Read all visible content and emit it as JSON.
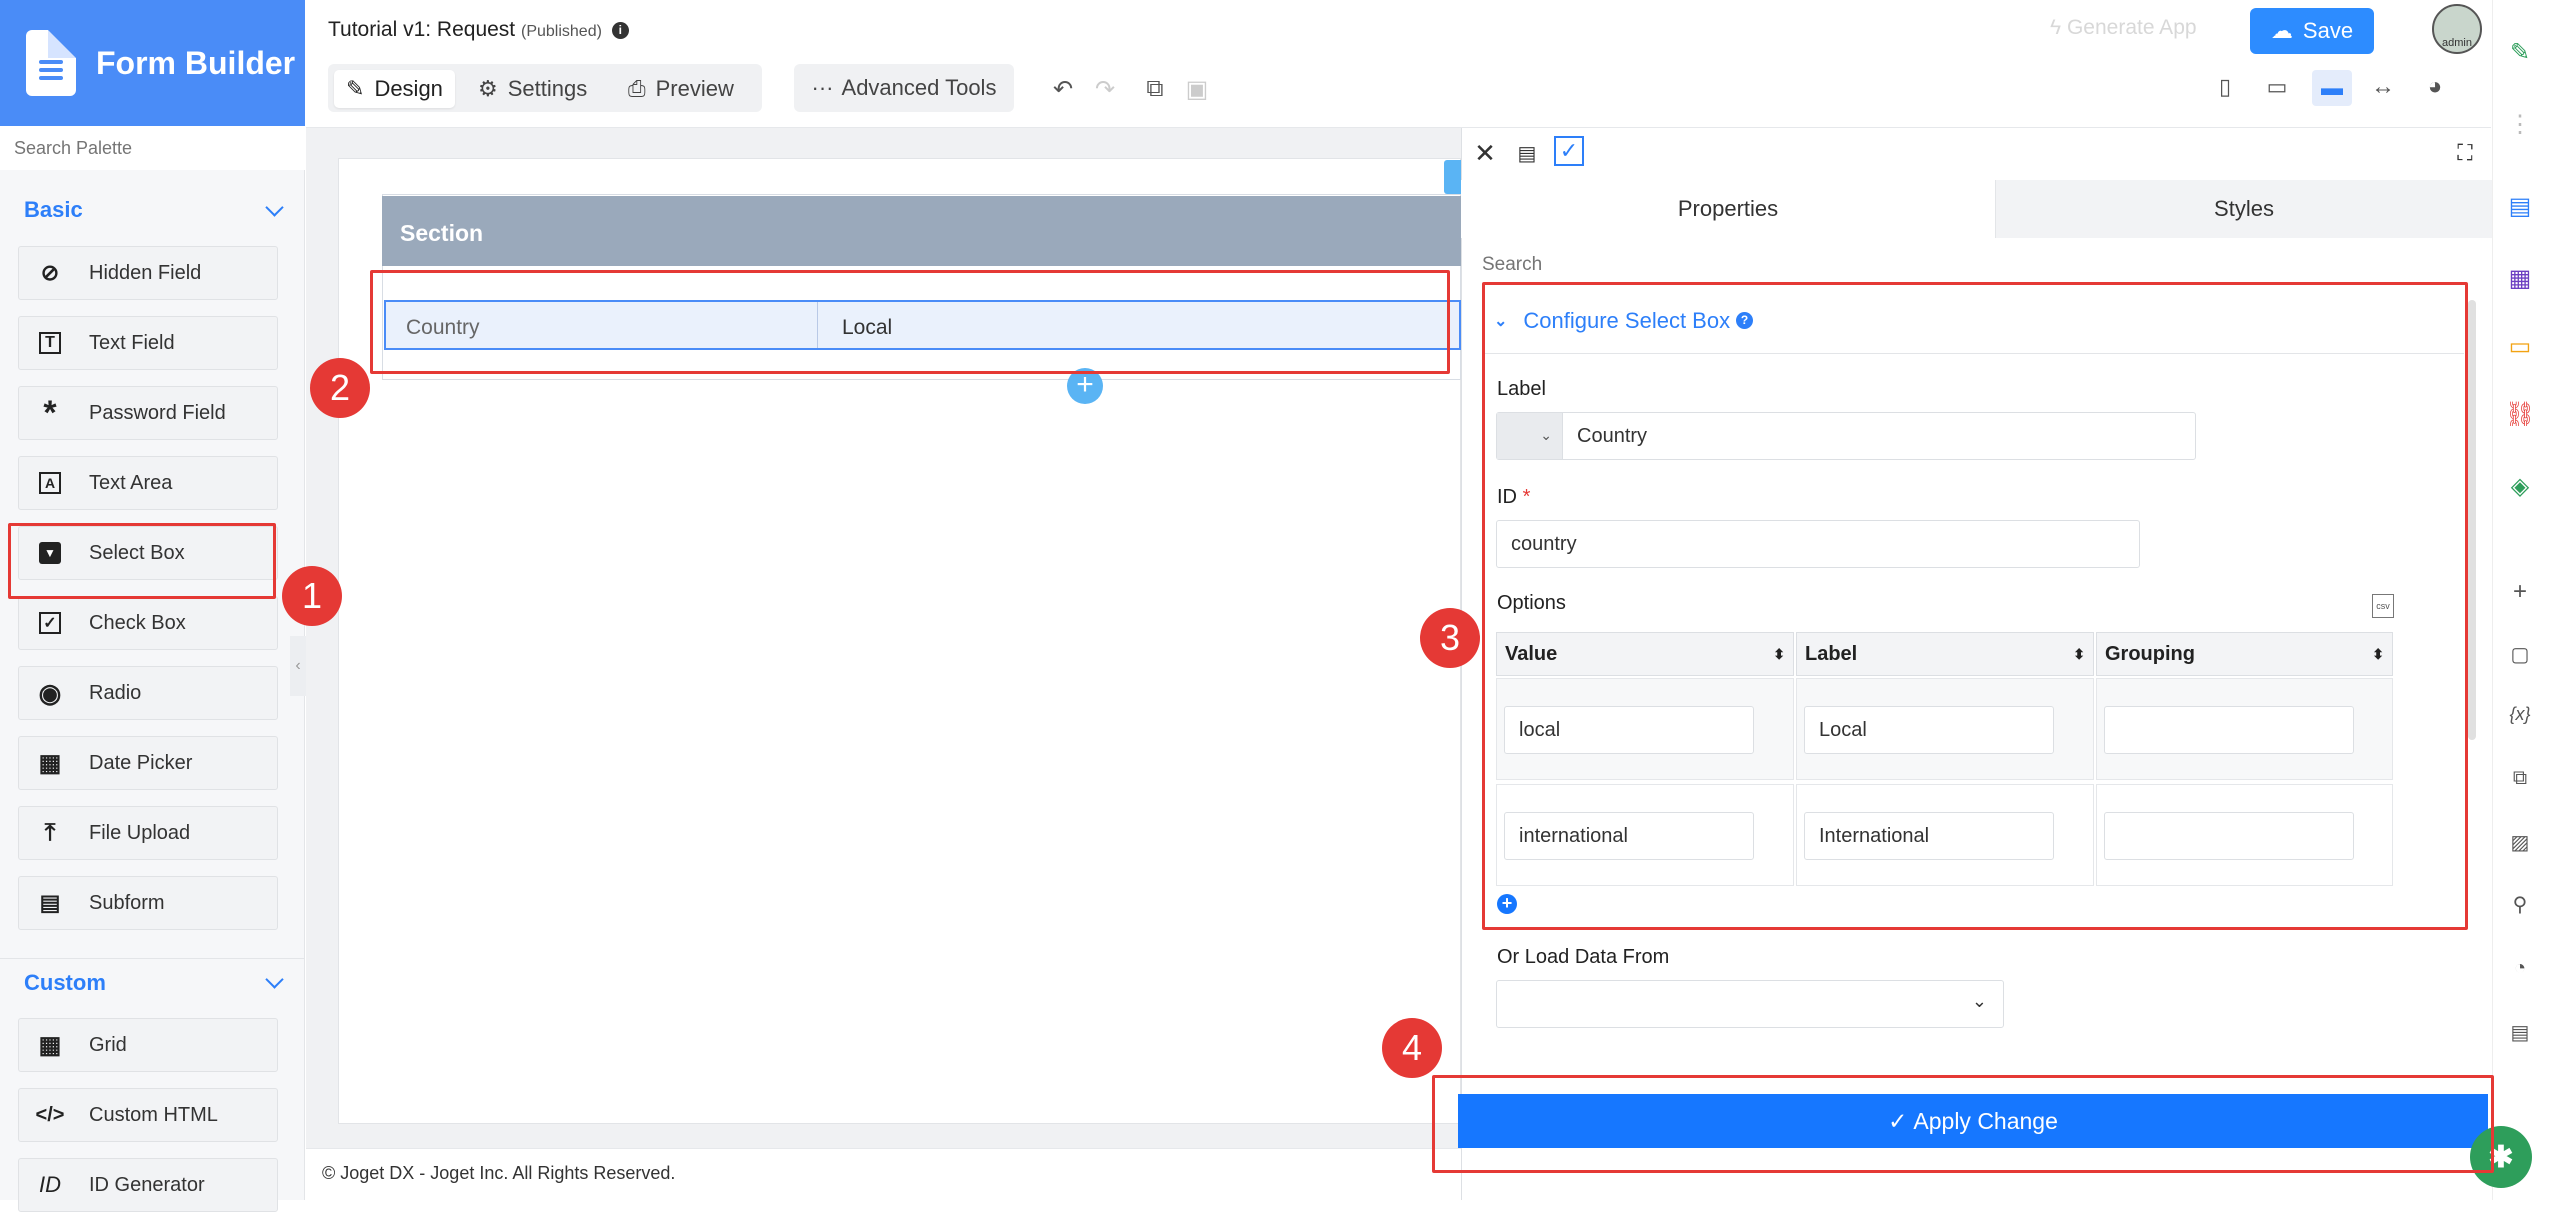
{
  "brand": {
    "title": "Form Builder"
  },
  "palette": {
    "search_placeholder": "Search Palette",
    "basic_label": "Basic",
    "custom_label": "Custom",
    "basic_items": [
      "Hidden Field",
      "Text Field",
      "Password Field",
      "Text Area",
      "Select Box",
      "Check Box",
      "Radio",
      "Date Picker",
      "File Upload",
      "Subform"
    ],
    "custom_items": [
      "Grid",
      "Custom HTML",
      "ID Generator"
    ]
  },
  "header": {
    "title": "Tutorial v1: Request",
    "status": "(Published)",
    "tabs": [
      "Design",
      "Settings",
      "Preview"
    ],
    "advanced_tools": "Advanced Tools",
    "generate_app": "Generate App",
    "save": "Save",
    "avatar_text": "admin"
  },
  "canvas": {
    "section_title": "Section",
    "field_label": "Country",
    "field_value": "Local"
  },
  "footer": {
    "text": "© Joget DX - Joget Inc. All Rights Reserved."
  },
  "panel": {
    "tab_properties": "Properties",
    "tab_styles": "Styles",
    "search_placeholder": "Search",
    "section_title": "Configure Select Box",
    "label_label": "Label",
    "label_value": "Country",
    "id_label": "ID",
    "id_value": "country",
    "options_label": "Options",
    "columns": [
      "Value",
      "Label",
      "Grouping"
    ],
    "rows": [
      {
        "value": "local",
        "label": "Local",
        "grouping": ""
      },
      {
        "value": "international",
        "label": "International",
        "grouping": ""
      }
    ],
    "load_data_label": "Or Load Data From",
    "apply_label": "Apply Change"
  },
  "annotations": [
    "1",
    "2",
    "3",
    "4"
  ],
  "colors": {
    "accent": "#2d7ff9",
    "apply": "#1677ff",
    "annotation": "#e53935",
    "section": "#9aa9bb"
  }
}
